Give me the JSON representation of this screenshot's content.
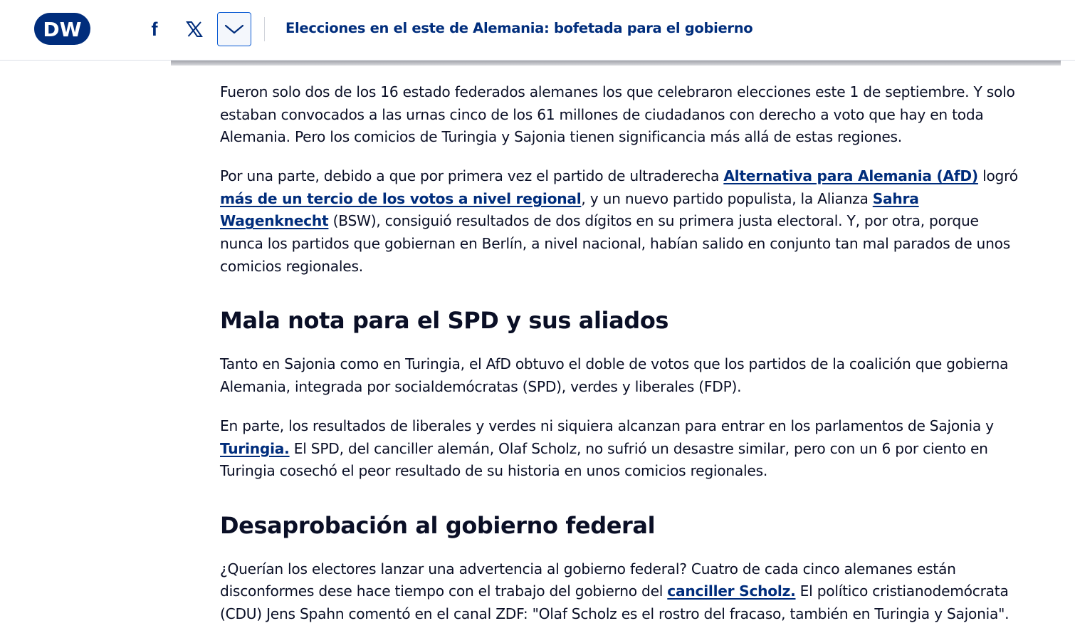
{
  "header": {
    "logo_text": "DW",
    "title": "Elecciones en el este de Alemania: bofetada para el gobierno",
    "share": {
      "facebook_icon": "facebook-icon",
      "x_icon": "x-icon",
      "more_icon": "chevron-down-icon"
    }
  },
  "article": {
    "p1": "Fueron solo dos de los 16 estado federados alemanes los que celebraron elecciones este 1 de septiembre. Y solo estaban convocados a las urnas cinco de los 61 millones de ciudadanos con derecho a voto que hay en toda Alemania. Pero los comicios de Turingia y Sajonia tienen significancia más allá de estas regiones.",
    "p2": {
      "t1": "Por una parte, debido a que por primera vez el partido de ultraderecha ",
      "link1": "Alternativa para Alemania (AfD)",
      "t2": " logró ",
      "link2": "más de un tercio de los votos a nivel regional",
      "t3": ", y un nuevo partido populista, la Alianza ",
      "link3": "Sahra Wagenknecht",
      "t4": " (BSW), consiguió resultados de dos dígitos en su primera justa electoral. Y, por otra, porque nunca los partidos que gobiernan en Berlín, a nivel nacional, habían salido en conjunto tan mal parados de unos comicios regionales."
    },
    "h2_1": "Mala nota para el SPD y sus aliados",
    "p3": "Tanto en Sajonia como en Turingia, el AfD obtuvo el doble de votos que los partidos de la coalición que gobierna Alemania, integrada por socialdemócratas (SPD), verdes y liberales (FDP).",
    "p4": {
      "t1": "En parte, los resultados de liberales y verdes ni siquiera alcanzan para entrar en los parlamentos de Sajonia y ",
      "link1": "Turingia.",
      "t2": " El SPD, del canciller alemán, Olaf Scholz, no sufrió un desastre similar, pero con un 6 por ciento en Turingia cosechó el peor resultado de su historia en unos comicios regionales."
    },
    "h2_2": "Desaprobación al gobierno federal",
    "p5": {
      "t1": "¿Querían los electores lanzar una advertencia al gobierno federal? Cuatro de cada cinco alemanes están disconformes dese hace tiempo con el trabajo del gobierno del ",
      "link1": "canciller Scholz.",
      "t2": " El político cristianodemócrata (CDU) Jens Spahn comentó en el canal ZDF: \"Olaf Scholz es el rostro del fracaso, también en Turingia y Sajonia\"."
    }
  },
  "colors": {
    "brand": "#002d7c",
    "text": "#0a0f26",
    "focus_border": "#0a5bd3"
  }
}
